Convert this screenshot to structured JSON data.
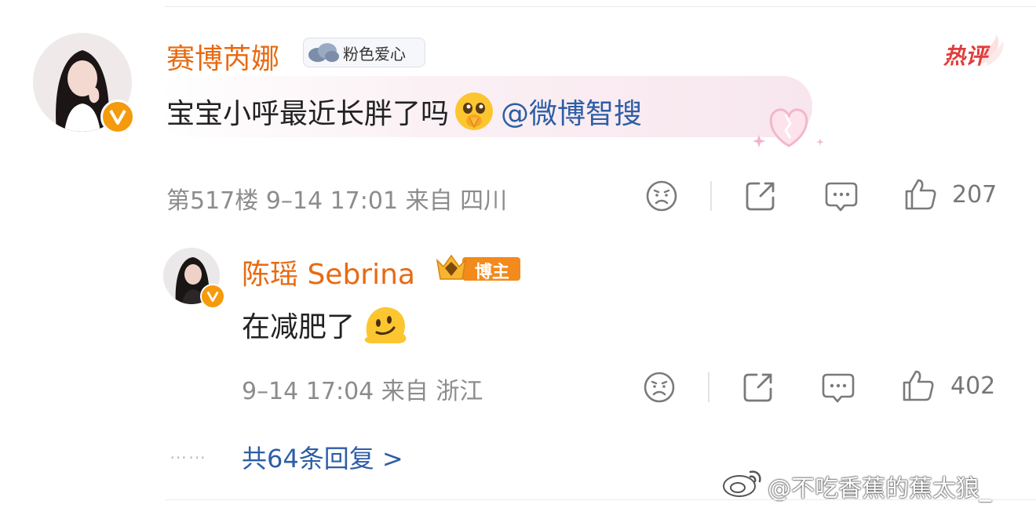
{
  "comment": {
    "author": "赛博芮娜",
    "fan_badge_label": "粉色爱心",
    "hot_label": "热评",
    "text": "宝宝小呼最近长胖了吗",
    "mention": "@微博智搜",
    "meta": "第517楼 9–14 17:01 来自 四川",
    "like_count": "207"
  },
  "reply": {
    "author": "陈瑶 Sebrina",
    "author_tag": "博主",
    "text": "在减肥了",
    "meta": "9–14 17:04 来自 浙江",
    "like_count": "402"
  },
  "more_replies": {
    "dots": "……",
    "label": "共64条回复 >"
  },
  "watermark": "@不吃香蕉的蕉太狼_",
  "colors": {
    "name": "#e86a12",
    "link": "#2d5ea6",
    "meta": "#8c8c8c",
    "verified": "#f59a0c"
  }
}
